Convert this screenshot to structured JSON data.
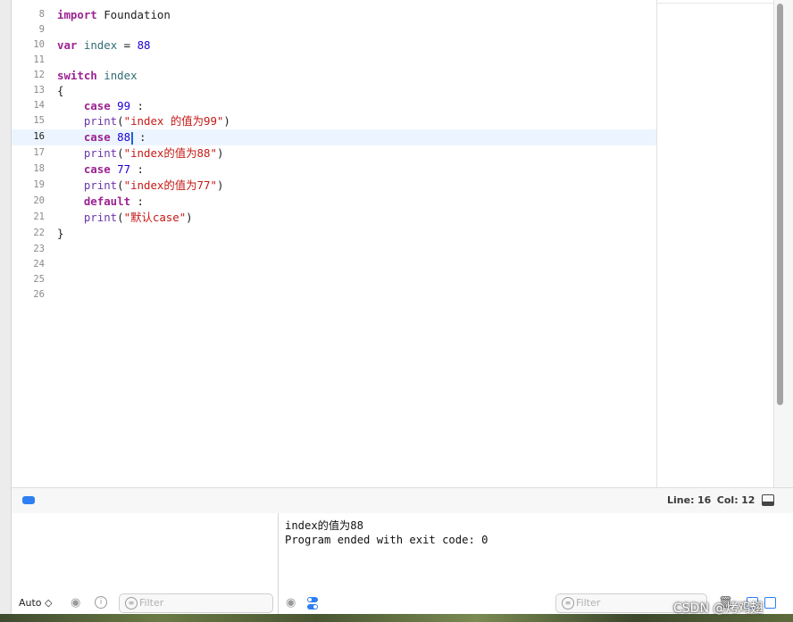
{
  "editor": {
    "lines": [
      {
        "n": "8",
        "tokens": [
          [
            "kw",
            "import"
          ],
          [
            "punc",
            " Foundation"
          ]
        ]
      },
      {
        "n": "9",
        "tokens": []
      },
      {
        "n": "10",
        "tokens": [
          [
            "kw",
            "var"
          ],
          [
            "punc",
            " "
          ],
          [
            "id",
            "index"
          ],
          [
            "punc",
            " = "
          ],
          [
            "num",
            "88"
          ]
        ]
      },
      {
        "n": "11",
        "tokens": []
      },
      {
        "n": "12",
        "tokens": [
          [
            "kw",
            "switch"
          ],
          [
            "punc",
            " "
          ],
          [
            "id",
            "index"
          ]
        ]
      },
      {
        "n": "13",
        "tokens": [
          [
            "punc",
            "{"
          ]
        ]
      },
      {
        "n": "14",
        "tokens": [
          [
            "punc",
            "    "
          ],
          [
            "kw",
            "case"
          ],
          [
            "punc",
            " "
          ],
          [
            "num",
            "99"
          ],
          [
            "punc",
            " :"
          ]
        ]
      },
      {
        "n": "15",
        "tokens": [
          [
            "punc",
            "    "
          ],
          [
            "fn",
            "print"
          ],
          [
            "punc",
            "("
          ],
          [
            "str",
            "\"index 的值为99\""
          ],
          [
            "punc",
            ")"
          ]
        ]
      },
      {
        "n": "16",
        "tokens": [
          [
            "punc",
            "    "
          ],
          [
            "kw",
            "case"
          ],
          [
            "punc",
            " "
          ],
          [
            "num",
            "88"
          ],
          [
            "cursor",
            ""
          ],
          [
            "punc",
            " :"
          ]
        ],
        "current": true
      },
      {
        "n": "17",
        "tokens": [
          [
            "punc",
            "    "
          ],
          [
            "fn",
            "print"
          ],
          [
            "punc",
            "("
          ],
          [
            "str",
            "\"index的值为88\""
          ],
          [
            "punc",
            ")"
          ]
        ]
      },
      {
        "n": "18",
        "tokens": [
          [
            "punc",
            "    "
          ],
          [
            "kw",
            "case"
          ],
          [
            "punc",
            " "
          ],
          [
            "num",
            "77"
          ],
          [
            "punc",
            " :"
          ]
        ]
      },
      {
        "n": "19",
        "tokens": [
          [
            "punc",
            "    "
          ],
          [
            "fn",
            "print"
          ],
          [
            "punc",
            "("
          ],
          [
            "str",
            "\"index的值为77\""
          ],
          [
            "punc",
            ")"
          ]
        ]
      },
      {
        "n": "20",
        "tokens": [
          [
            "punc",
            "    "
          ],
          [
            "kw",
            "default"
          ],
          [
            "punc",
            " :"
          ]
        ]
      },
      {
        "n": "21",
        "tokens": [
          [
            "punc",
            "    "
          ],
          [
            "fn",
            "print"
          ],
          [
            "punc",
            "("
          ],
          [
            "str",
            "\"默认case\""
          ],
          [
            "punc",
            ")"
          ]
        ]
      },
      {
        "n": "22",
        "tokens": [
          [
            "punc",
            "}"
          ]
        ]
      },
      {
        "n": "23",
        "tokens": []
      },
      {
        "n": "24",
        "tokens": []
      },
      {
        "n": "25",
        "tokens": []
      },
      {
        "n": "26",
        "tokens": []
      }
    ]
  },
  "status": {
    "line_label": "Line:",
    "line_value": "16",
    "col_label": "Col:",
    "col_value": "12"
  },
  "variables_pane": {
    "scope_select": "Auto ◇",
    "filter_placeholder": "Filter"
  },
  "console": {
    "output": [
      "index的值为88",
      "Program ended with exit code: 0"
    ],
    "filter_placeholder": "Filter"
  },
  "watermark": "CSDN @烤鸡翅",
  "colors": {
    "keyword": "#9b2393",
    "string": "#c41a16",
    "number": "#1c00cf",
    "identifier": "#326d74",
    "accent": "#2d7ff2"
  }
}
